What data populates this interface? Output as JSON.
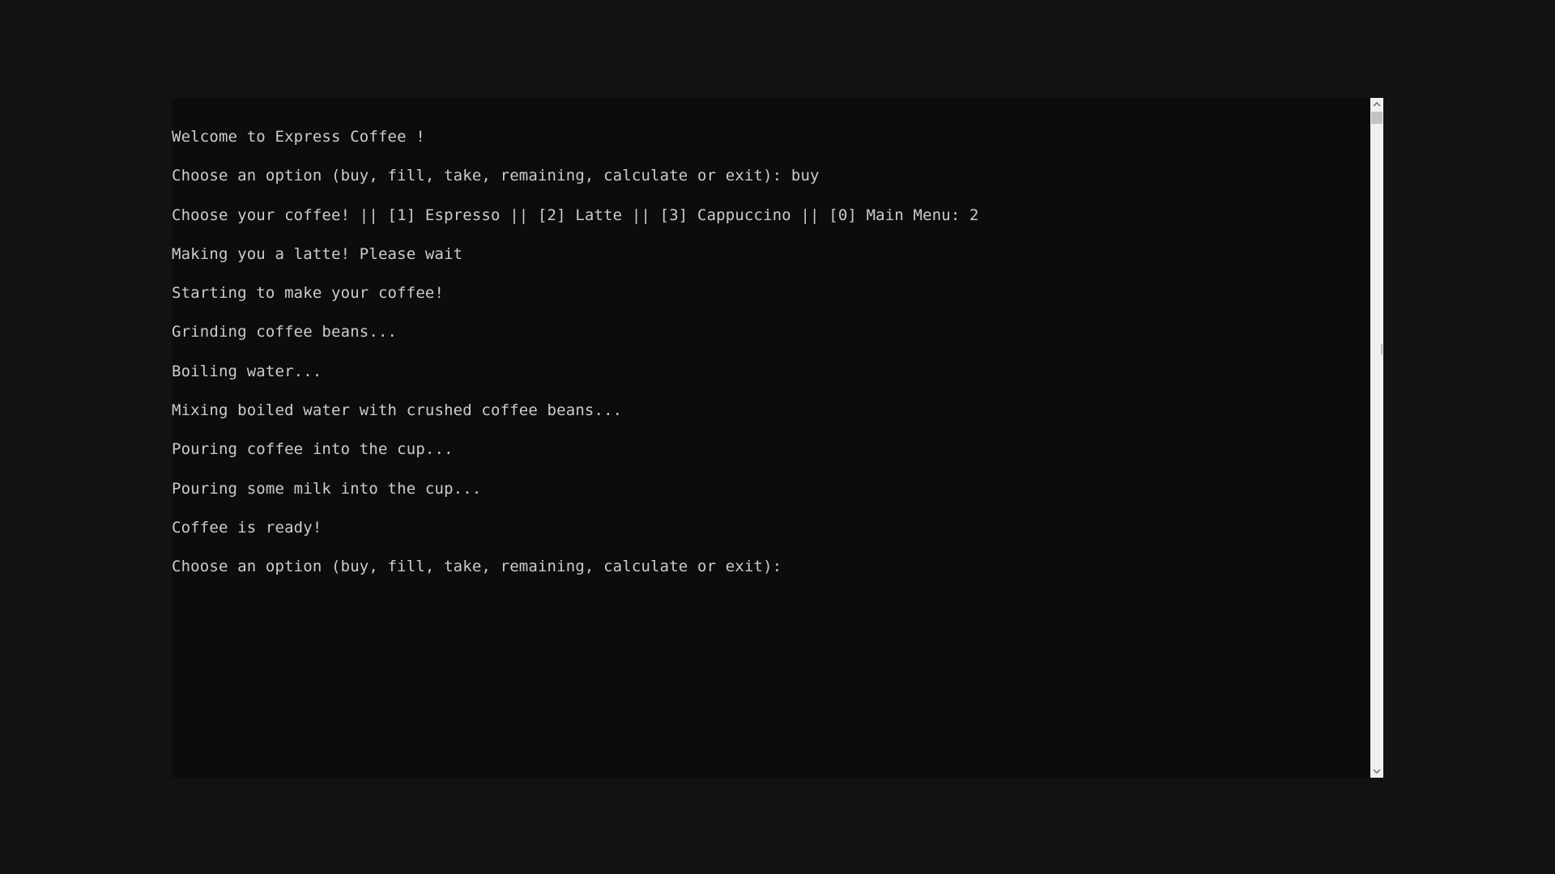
{
  "console": {
    "lines": [
      "Welcome to Express Coffee !",
      "Choose an option (buy, fill, take, remaining, calculate or exit): buy",
      "Choose your coffee! || [1] Espresso || [2] Latte || [3] Cappuccino || [0] Main Menu: 2",
      "Making you a latte! Please wait",
      "Starting to make your coffee!",
      "Grinding coffee beans...",
      "Boiling water...",
      "Mixing boiled water with crushed coffee beans...",
      "Pouring coffee into the cup...",
      "Pouring some milk into the cup...",
      "Coffee is ready!",
      "Choose an option (buy, fill, take, remaining, calculate or exit): "
    ]
  },
  "scrollbar": {
    "up_icon": "chevron-up-icon",
    "down_icon": "chevron-down-icon",
    "position": 0
  },
  "colors": {
    "page_background": "#121212",
    "console_background": "#0c0c0d",
    "console_text": "#cccccc",
    "scrollbar_track": "#f0f0f0"
  }
}
